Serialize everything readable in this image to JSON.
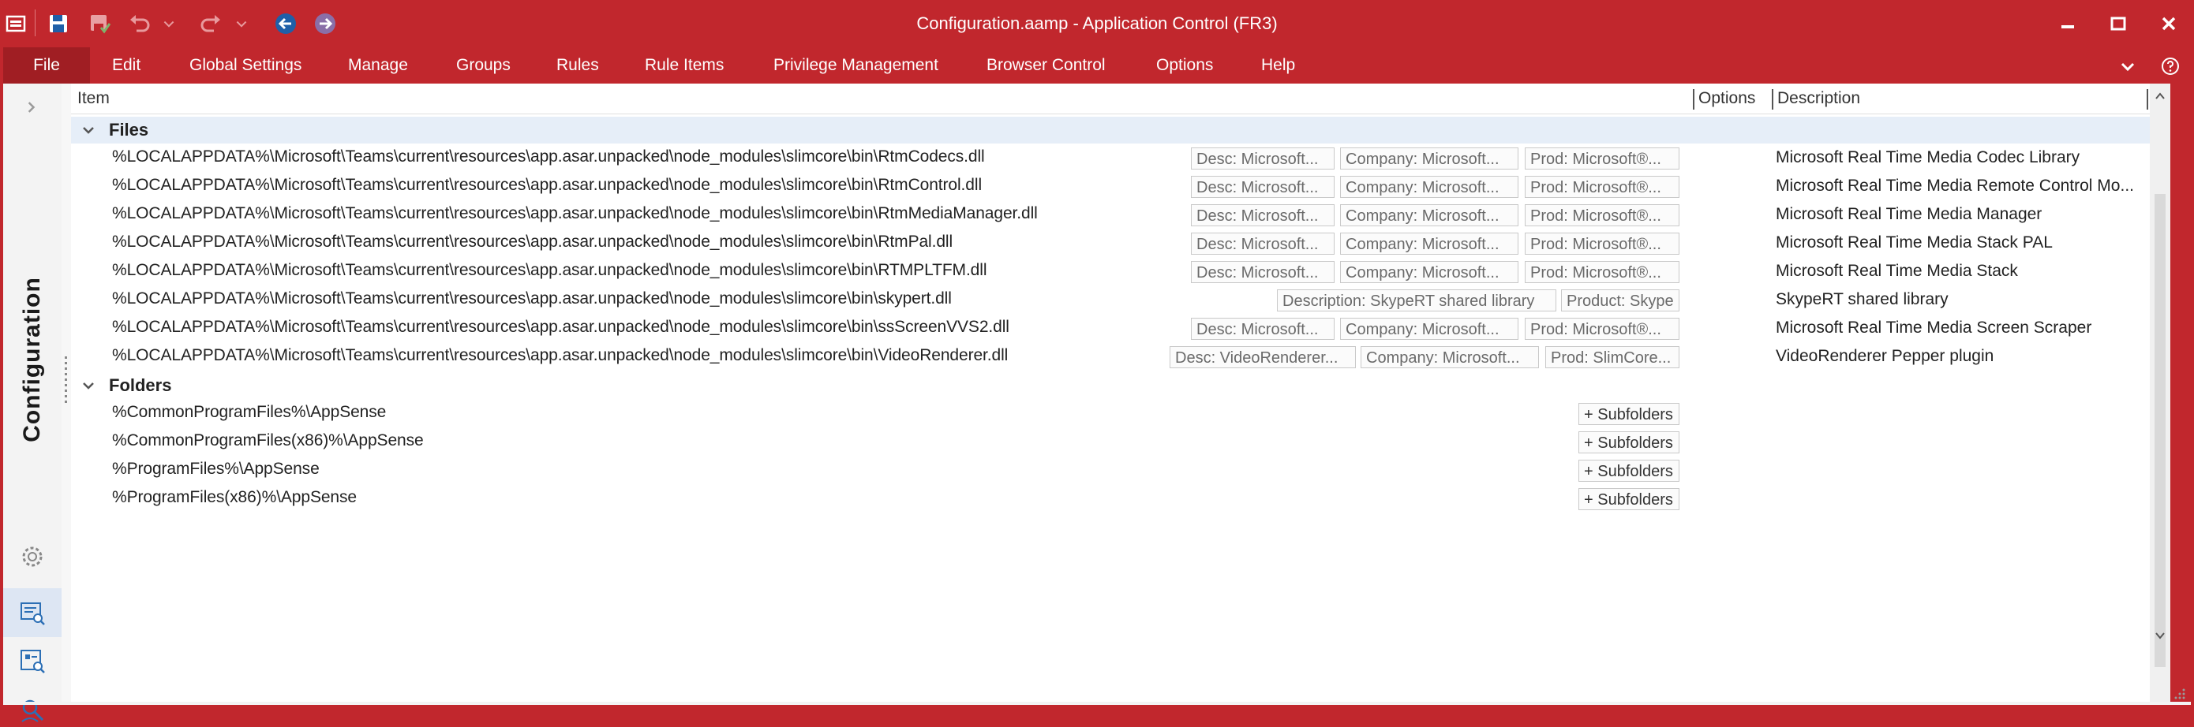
{
  "window": {
    "title": "Configuration.aamp - Application Control (FR3)",
    "accent": "#c1272d"
  },
  "quick_access": [
    "app-menu-icon",
    "save-icon",
    "save-and-deploy-icon",
    "undo-icon",
    "undo-dropdown-icon",
    "redo-icon",
    "redo-dropdown-icon",
    "back-icon",
    "forward-icon"
  ],
  "menu": {
    "items": [
      "File",
      "Edit",
      "Global Settings",
      "Manage",
      "Groups",
      "Rules",
      "Rule Items",
      "Privilege Management",
      "Browser Control",
      "Options",
      "Help"
    ]
  },
  "side_panel": {
    "label": "Configuration",
    "icons": [
      "expand-icon",
      "settings-gear-icon",
      "configuration-view-icon",
      "rules-view-icon",
      "search-view-icon"
    ]
  },
  "grid": {
    "columns": [
      "Item",
      "Options",
      "Description"
    ],
    "groups": [
      {
        "label": "Files",
        "rows": [
          {
            "path": "%LOCALAPPDATA%\\Microsoft\\Teams\\current\\resources\\app.asar.unpacked\\node_modules\\slimcore\\bin\\RtmCodecs.dll",
            "tags": [
              "Desc: Microsoft...",
              "Company: Microsoft...",
              "Prod: Microsoft®..."
            ],
            "description": "Microsoft Real Time Media Codec Library"
          },
          {
            "path": "%LOCALAPPDATA%\\Microsoft\\Teams\\current\\resources\\app.asar.unpacked\\node_modules\\slimcore\\bin\\RtmControl.dll",
            "tags": [
              "Desc: Microsoft...",
              "Company: Microsoft...",
              "Prod: Microsoft®..."
            ],
            "description": "Microsoft Real Time Media Remote Control Mo..."
          },
          {
            "path": "%LOCALAPPDATA%\\Microsoft\\Teams\\current\\resources\\app.asar.unpacked\\node_modules\\slimcore\\bin\\RtmMediaManager.dll",
            "tags": [
              "Desc: Microsoft...",
              "Company: Microsoft...",
              "Prod: Microsoft®..."
            ],
            "description": "Microsoft Real Time Media Manager"
          },
          {
            "path": "%LOCALAPPDATA%\\Microsoft\\Teams\\current\\resources\\app.asar.unpacked\\node_modules\\slimcore\\bin\\RtmPal.dll",
            "tags": [
              "Desc: Microsoft...",
              "Company: Microsoft...",
              "Prod: Microsoft®..."
            ],
            "description": "Microsoft Real Time Media Stack PAL"
          },
          {
            "path": "%LOCALAPPDATA%\\Microsoft\\Teams\\current\\resources\\app.asar.unpacked\\node_modules\\slimcore\\bin\\RTMPLTFM.dll",
            "tags": [
              "Desc: Microsoft...",
              "Company: Microsoft...",
              "Prod: Microsoft®..."
            ],
            "description": "Microsoft Real Time Media Stack"
          },
          {
            "path": "%LOCALAPPDATA%\\Microsoft\\Teams\\current\\resources\\app.asar.unpacked\\node_modules\\slimcore\\bin\\skypert.dll",
            "tags": [
              "Description: SkypeRT shared library",
              "Product: Skype"
            ],
            "description": "SkypeRT shared library"
          },
          {
            "path": "%LOCALAPPDATA%\\Microsoft\\Teams\\current\\resources\\app.asar.unpacked\\node_modules\\slimcore\\bin\\ssScreenVVS2.dll",
            "tags": [
              "Desc: Microsoft...",
              "Company: Microsoft...",
              "Prod: Microsoft®..."
            ],
            "description": "Microsoft Real Time Media Screen Scraper"
          },
          {
            "path": "%LOCALAPPDATA%\\Microsoft\\Teams\\current\\resources\\app.asar.unpacked\\node_modules\\slimcore\\bin\\VideoRenderer.dll",
            "tags": [
              "Desc: VideoRenderer...",
              "Company: Microsoft...",
              "Prod: SlimCore..."
            ],
            "description": "VideoRenderer Pepper plugin"
          }
        ]
      },
      {
        "label": "Folders",
        "rows": [
          {
            "path": "%CommonProgramFiles%\\AppSense",
            "tags": [
              "+ Subfolders"
            ],
            "description": ""
          },
          {
            "path": "%CommonProgramFiles(x86)%\\AppSense",
            "tags": [
              "+ Subfolders"
            ],
            "description": ""
          },
          {
            "path": "%ProgramFiles%\\AppSense",
            "tags": [
              "+ Subfolders"
            ],
            "description": ""
          },
          {
            "path": "%ProgramFiles(x86)%\\AppSense",
            "tags": [
              "+ Subfolders"
            ],
            "description": ""
          }
        ]
      }
    ]
  }
}
